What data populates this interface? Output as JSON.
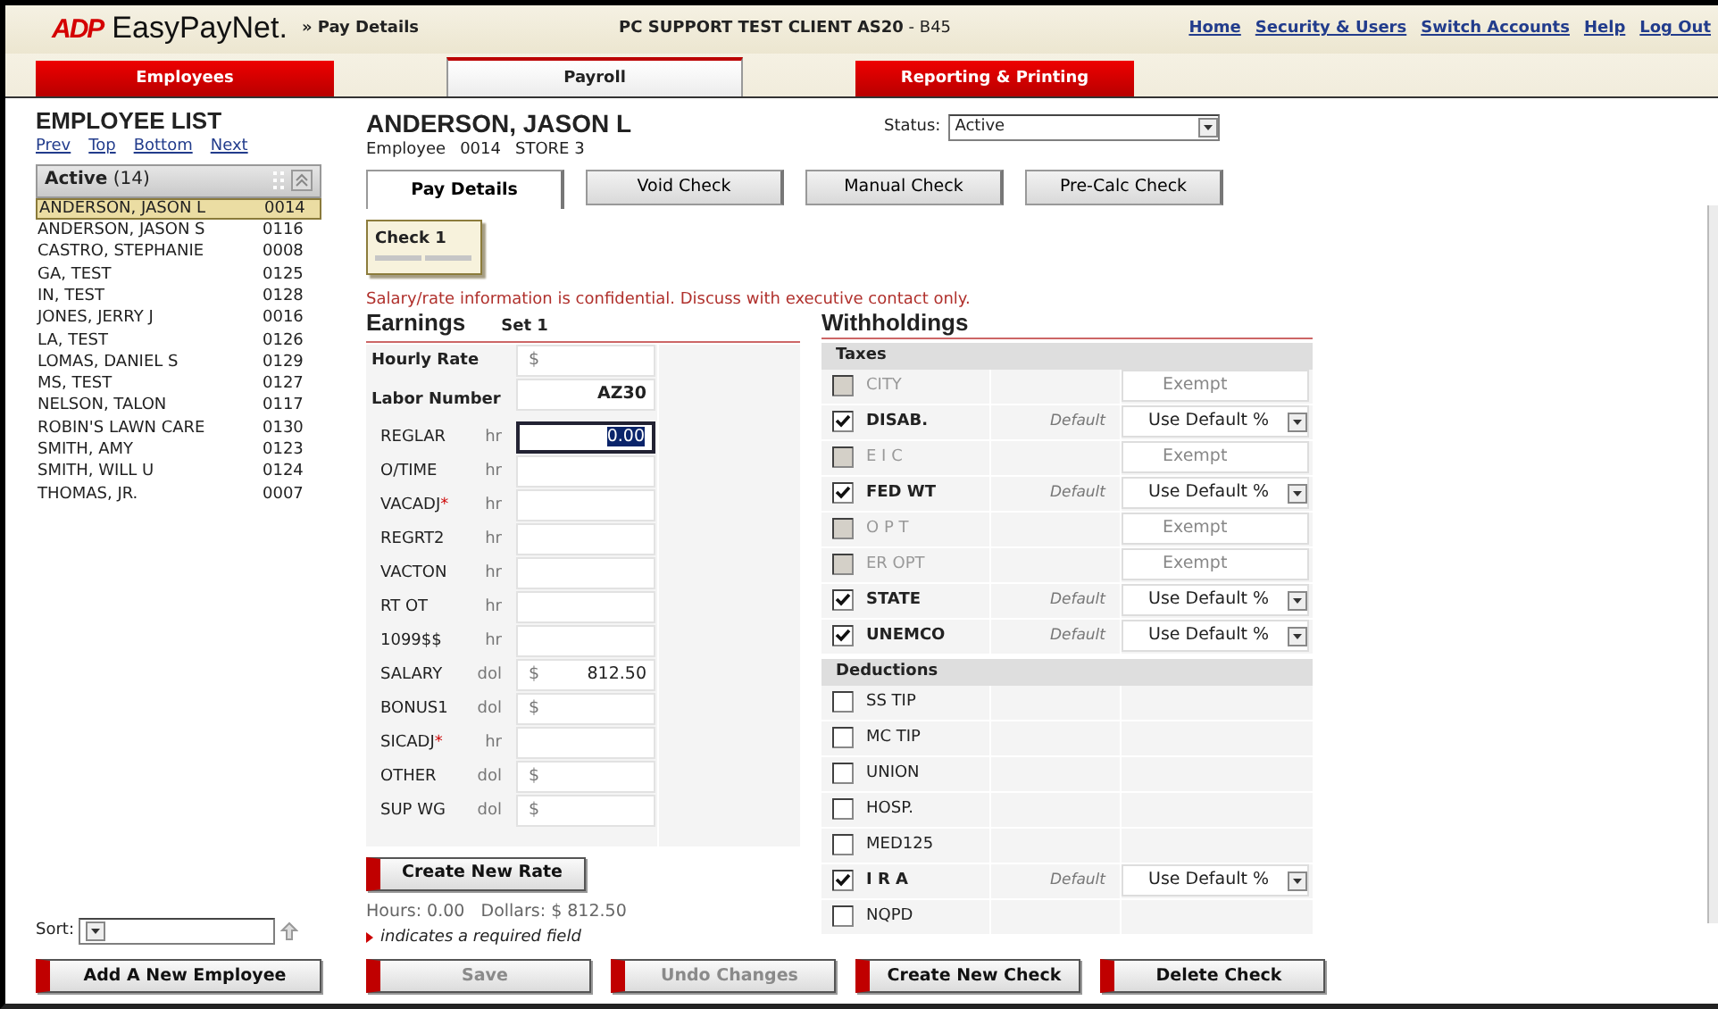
{
  "header": {
    "logo": "ADP",
    "app_name": "EasyPayNet.",
    "breadcrumb": "» Pay Details",
    "client": "**PC SUPPORT TEST CLIENT AS20** - B45",
    "links": [
      "Home",
      "Security & Users",
      "Switch Accounts",
      "Help",
      "Log Out"
    ]
  },
  "main_tabs": [
    {
      "label": "Employees",
      "selected": false
    },
    {
      "label": "Payroll",
      "selected": true
    },
    {
      "label": "Reporting & Printing",
      "selected": false
    }
  ],
  "employee_list": {
    "title": "EMPLOYEE LIST",
    "nav_links": [
      "Prev",
      "Top",
      "Bottom",
      "Next"
    ],
    "group": "Active",
    "count": "(14)",
    "employees": [
      {
        "name": "ANDERSON, JASON L",
        "number": "0014",
        "selected": true
      },
      {
        "name": "ANDERSON, JASON S",
        "number": "0116",
        "selected": false
      },
      {
        "name": "CASTRO, STEPHANIE",
        "number": "0008",
        "selected": false
      },
      {
        "name": "GA, TEST",
        "number": "0125",
        "selected": false
      },
      {
        "name": "IN, TEST",
        "number": "0128",
        "selected": false
      },
      {
        "name": "JONES, JERRY J",
        "number": "0016",
        "selected": false
      },
      {
        "name": "LA, TEST",
        "number": "0126",
        "selected": false
      },
      {
        "name": "LOMAS, DANIEL S",
        "number": "0129",
        "selected": false
      },
      {
        "name": "MS, TEST",
        "number": "0127",
        "selected": false
      },
      {
        "name": "NELSON, TALON",
        "number": "0117",
        "selected": false
      },
      {
        "name": "ROBIN'S LAWN CARE",
        "number": "0130",
        "selected": false
      },
      {
        "name": "SMITH, AMY",
        "number": "0123",
        "selected": false
      },
      {
        "name": "SMITH, WILL U",
        "number": "0124",
        "selected": false
      },
      {
        "name": "THOMAS, JR.",
        "number": "0007",
        "selected": false
      }
    ],
    "sort_label": "Sort:",
    "add_button": "Add A New Employee"
  },
  "employee": {
    "name": "ANDERSON, JASON L",
    "id_label": "Employee",
    "id": "0014",
    "store": "STORE 3",
    "status_label": "Status:",
    "status": "Active"
  },
  "sub_tabs": [
    {
      "label": "Pay Details",
      "selected": true
    },
    {
      "label": "Void Check",
      "selected": false
    },
    {
      "label": "Manual Check",
      "selected": false
    },
    {
      "label": "Pre-Calc Check",
      "selected": false
    }
  ],
  "checks": [
    {
      "label": "Check 1",
      "selected": true
    }
  ],
  "notice": "Salary/rate information is confidential. Discuss with executive contact only.",
  "earnings": {
    "title": "Earnings",
    "set": "Set 1",
    "rate_label": "Hourly Rate",
    "rate_prefix": "$",
    "labor_label": "Labor Number",
    "labor_value": "AZ30",
    "rows": [
      {
        "code": "REGLAR",
        "unit": "hr",
        "value": "0.00",
        "focused": true
      },
      {
        "code": "O/TIME",
        "unit": "hr",
        "focused": false
      },
      {
        "code": "VACADJ",
        "required_mark": "*",
        "unit": "hr",
        "focused": false
      },
      {
        "code": "REGRT2",
        "unit": "hr",
        "focused": false
      },
      {
        "code": "VACTON",
        "unit": "hr",
        "focused": false
      },
      {
        "code": "RT OT",
        "unit": "hr",
        "focused": false
      },
      {
        "code": "1099$$",
        "unit": "hr",
        "focused": false
      },
      {
        "code": "SALARY",
        "unit": "dol",
        "prefix": "$",
        "value": "812.50",
        "focused": false
      },
      {
        "code": "BONUS1",
        "unit": "dol",
        "prefix": "$",
        "focused": false
      },
      {
        "code": "SICADJ",
        "required_mark": "*",
        "unit": "hr",
        "focused": false
      },
      {
        "code": "OTHER",
        "unit": "dol",
        "prefix": "$",
        "focused": false
      },
      {
        "code": "SUP WG",
        "unit": "dol",
        "prefix": "$",
        "focused": false
      }
    ],
    "create_rate_button": "Create New Rate",
    "totals": "Hours: 0.00   Dollars: $ 812.50",
    "required_note": "indicates a required field"
  },
  "withholdings": {
    "title": "Withholdings",
    "sections": [
      {
        "title": "Taxes",
        "items": [
          {
            "name": "CITY",
            "checked": false,
            "disabled": true,
            "kind": "exempt",
            "value": "Exempt"
          },
          {
            "name": "DISAB.",
            "checked": true,
            "disabled": false,
            "kind": "select",
            "note": "Default",
            "value": "Use Default %"
          },
          {
            "name": "E I C",
            "checked": false,
            "disabled": true,
            "kind": "exempt",
            "value": "Exempt"
          },
          {
            "name": "FED WT",
            "checked": true,
            "disabled": false,
            "kind": "select",
            "note": "Default",
            "value": "Use Default %"
          },
          {
            "name": "O P T",
            "checked": false,
            "disabled": true,
            "kind": "exempt",
            "value": "Exempt"
          },
          {
            "name": "ER OPT",
            "checked": false,
            "disabled": true,
            "kind": "exempt",
            "value": "Exempt"
          },
          {
            "name": "STATE",
            "checked": true,
            "disabled": false,
            "kind": "select",
            "note": "Default",
            "value": "Use Default %"
          },
          {
            "name": "UNEMCO",
            "checked": true,
            "disabled": false,
            "kind": "select",
            "note": "Default",
            "value": "Use Default %"
          }
        ]
      },
      {
        "title": "Deductions",
        "items": [
          {
            "name": "SS TIP",
            "checked": false,
            "disabled": false,
            "kind": "blank"
          },
          {
            "name": "MC TIP",
            "checked": false,
            "disabled": false,
            "kind": "blank"
          },
          {
            "name": "UNION",
            "checked": false,
            "disabled": false,
            "kind": "blank"
          },
          {
            "name": "HOSP.",
            "checked": false,
            "disabled": false,
            "kind": "blank"
          },
          {
            "name": "MED125",
            "checked": false,
            "disabled": false,
            "kind": "blank"
          },
          {
            "name": "I R A",
            "checked": true,
            "disabled": false,
            "kind": "select",
            "note": "Default",
            "value": "Use Default %"
          },
          {
            "name": "NQPD",
            "checked": false,
            "disabled": false,
            "kind": "blank"
          }
        ]
      }
    ]
  },
  "actions": [
    {
      "label": "Save",
      "disabled": true
    },
    {
      "label": "Undo Changes",
      "disabled": true
    },
    {
      "label": "Create New Check",
      "disabled": false
    },
    {
      "label": "Delete Check",
      "disabled": false
    }
  ]
}
